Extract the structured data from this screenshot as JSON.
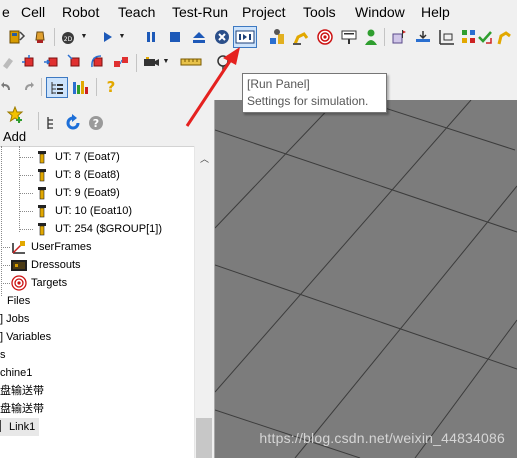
{
  "menubar": {
    "items": [
      {
        "id": "file-clip",
        "label": "e"
      },
      {
        "id": "cell",
        "label": "Cell"
      },
      {
        "id": "robot",
        "label": "Robot"
      },
      {
        "id": "teach",
        "label": "Teach"
      },
      {
        "id": "test-run",
        "label": "Test-Run"
      },
      {
        "id": "project",
        "label": "Project"
      },
      {
        "id": "tools",
        "label": "Tools"
      },
      {
        "id": "window",
        "label": "Window"
      },
      {
        "id": "help",
        "label": "Help"
      }
    ]
  },
  "tooltip": {
    "title": "[Run Panel]",
    "description": "Settings for simulation."
  },
  "left_panel": {
    "add_label": "Add",
    "tree": [
      {
        "label": "UT: 7  (Eoat7)"
      },
      {
        "label": "UT: 8  (Eoat8)"
      },
      {
        "label": "UT: 9  (Eoat9)"
      },
      {
        "label": "UT: 10  (Eoat10)"
      },
      {
        "label": "UT: 254  ($GROUP[1])"
      },
      {
        "label": "UserFrames"
      },
      {
        "label": "Dressouts"
      },
      {
        "label": "Targets"
      },
      {
        "label": "Files"
      },
      {
        "label": "] Jobs"
      },
      {
        "label": "] Variables"
      },
      {
        "label": "s"
      },
      {
        "label": "chine1"
      },
      {
        "label": "盘输送带"
      },
      {
        "label": "盘输送带"
      },
      {
        "label": "Link1"
      }
    ]
  },
  "viewport": {
    "watermark": "https://blog.csdn.net/weixin_44834086"
  },
  "colors": {
    "viewport_bg": "#7c7c7c",
    "grid_line": "#3c3c3c",
    "annotation_arrow": "#e5211f",
    "highlight_button": "#cde3fb"
  }
}
